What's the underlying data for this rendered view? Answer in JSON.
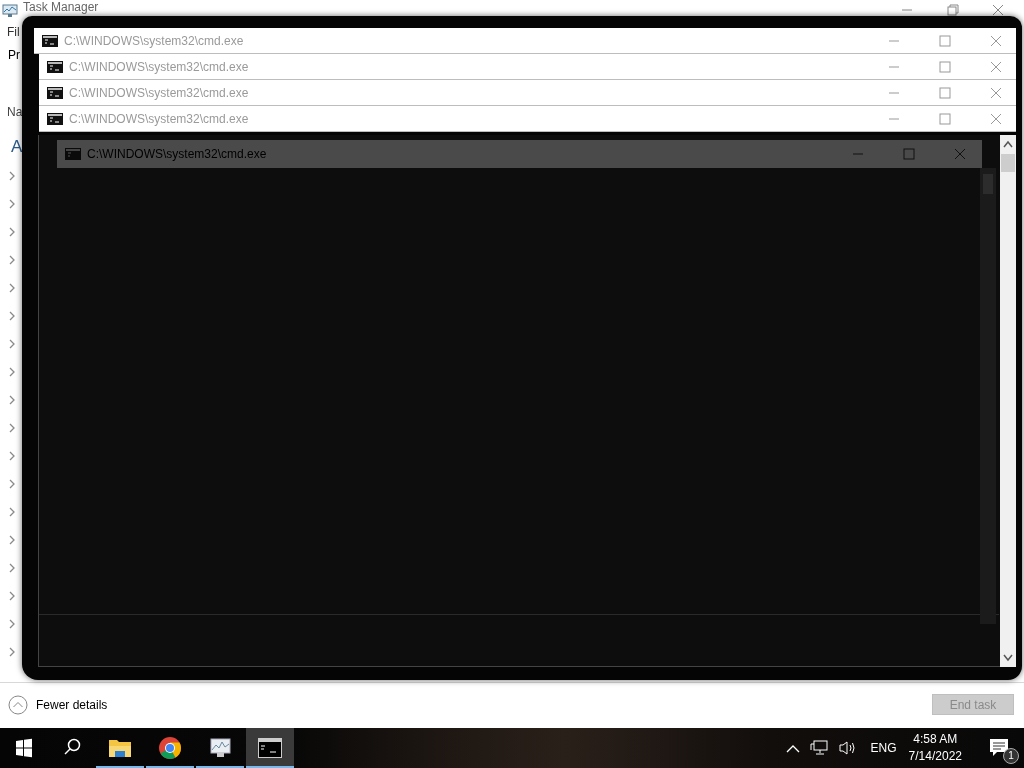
{
  "task_manager": {
    "title": "Task Manager",
    "menu_text": "Fil",
    "tab_text": "Pr",
    "column_text": "Na",
    "group_text": "A",
    "rows": [
      {
        "expanded": false
      },
      {
        "expanded": false
      },
      {
        "expanded": false
      },
      {
        "expanded": false
      },
      {
        "expanded": false
      },
      {
        "expanded": false
      },
      {
        "expanded": false
      },
      {
        "expanded": false
      },
      {
        "expanded": false
      },
      {
        "expanded": false
      },
      {
        "expanded": false
      },
      {
        "expanded": false
      },
      {
        "expanded": false
      },
      {
        "expanded": false
      },
      {
        "expanded": false
      },
      {
        "expanded": false
      },
      {
        "expanded": false
      },
      {
        "expanded": false
      }
    ],
    "fewer_details": "Fewer details",
    "end_task": {
      "label": "End task",
      "disabled": true
    }
  },
  "cmd_windows": [
    {
      "kind": "titlebar",
      "title": "C:\\WINDOWS\\system32\\cmd.exe"
    },
    {
      "kind": "titlebar",
      "title": "C:\\WINDOWS\\system32\\cmd.exe"
    },
    {
      "kind": "titlebar",
      "title": "C:\\WINDOWS\\system32\\cmd.exe"
    },
    {
      "kind": "titlebar",
      "title": "C:\\WINDOWS\\system32\\cmd.exe"
    },
    {
      "kind": "console",
      "title": "C:\\WINDOWS\\system32\\cmd.exe"
    }
  ],
  "taskbar": {
    "apps": [
      {
        "kind": "explorer",
        "running": true,
        "selected": false
      },
      {
        "kind": "chrome",
        "running": true,
        "selected": false
      },
      {
        "kind": "monitor",
        "running": true,
        "selected": false
      },
      {
        "kind": "console",
        "running": true,
        "selected": true
      }
    ],
    "tray": {
      "language": "ENG",
      "time": "4:58 AM",
      "date": "7/14/2022",
      "notifications": "1"
    }
  }
}
